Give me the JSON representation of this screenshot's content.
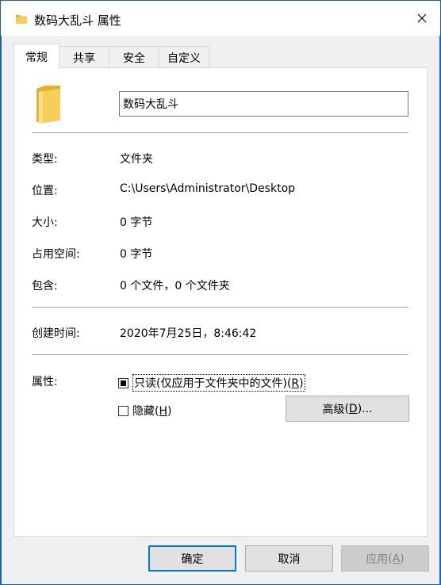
{
  "window": {
    "title": "数码大乱斗 属性",
    "close_icon": "close-icon"
  },
  "tabs": [
    {
      "label": "常规",
      "active": true
    },
    {
      "label": "共享",
      "active": false
    },
    {
      "label": "安全",
      "active": false
    },
    {
      "label": "自定义",
      "active": false
    }
  ],
  "general": {
    "folder_icon": "folder-icon",
    "name_value": "数码大乱斗",
    "type_label": "类型:",
    "type_value": "文件夹",
    "location_label": "位置:",
    "location_value": "C:\\Users\\Administrator\\Desktop",
    "size_label": "大小:",
    "size_value": "0 字节",
    "size_on_disk_label": "占用空间:",
    "size_on_disk_value": "0 字节",
    "contains_label": "包含:",
    "contains_value": "0 个文件，0 个文件夹",
    "created_label": "创建时间:",
    "created_value": "2020年7月25日，8:46:42",
    "attributes_label": "属性:",
    "readonly_label": "只读(仅应用于文件夹中的文件)",
    "readonly_mnemonic": "R",
    "readonly_state": "indeterminate",
    "hidden_label": "隐藏",
    "hidden_mnemonic": "H",
    "hidden_state": "unchecked",
    "advanced_label": "高级",
    "advanced_mnemonic": "D",
    "advanced_suffix": "..."
  },
  "buttons": {
    "ok": "确定",
    "cancel": "取消",
    "apply": "应用",
    "apply_mnemonic": "A"
  },
  "colors": {
    "accent": "#0078d7",
    "folder": "#f3c44a"
  }
}
